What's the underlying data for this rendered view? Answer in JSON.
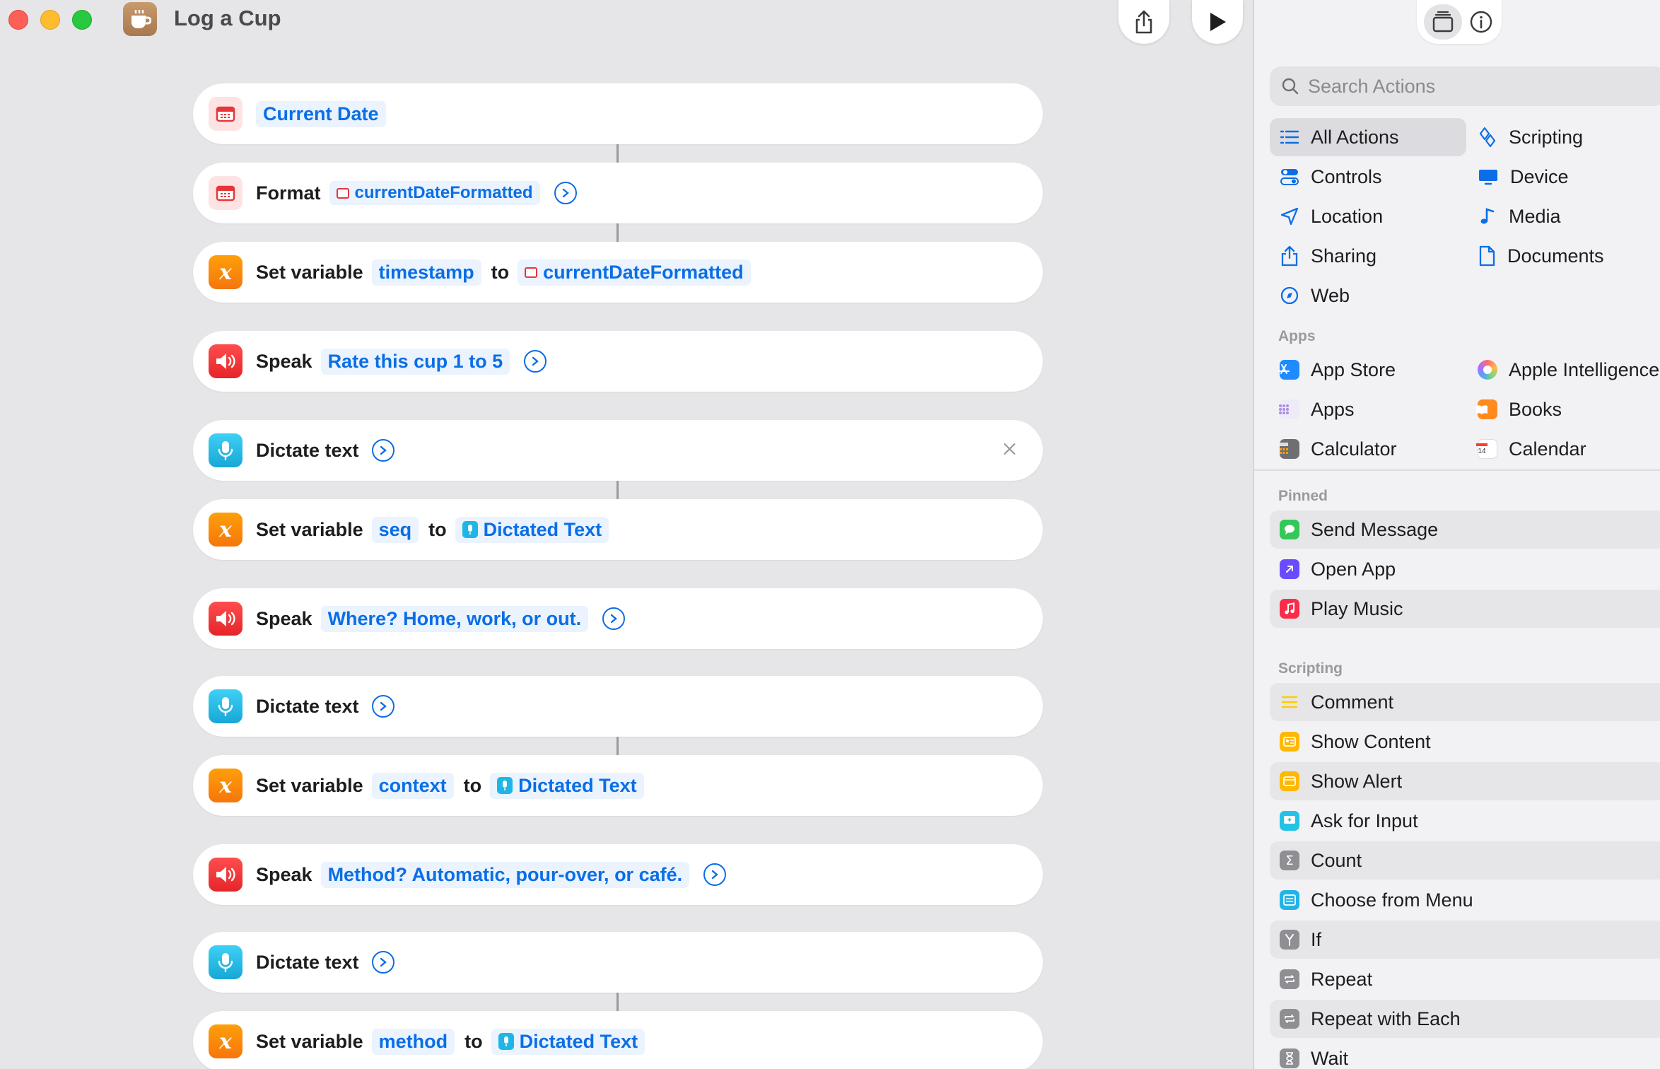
{
  "window": {
    "title": "Log a Cup"
  },
  "actions": [
    {
      "type": "date",
      "tokens": [
        {
          "text": "Current Date",
          "chip": "none"
        }
      ]
    },
    {
      "type": "format",
      "verb": "Format",
      "tokens": [
        {
          "text": "currentDateFormatted",
          "chip": "cal"
        }
      ]
    },
    {
      "type": "setvar",
      "verb": "Set variable",
      "var": "timestamp",
      "to": "to",
      "value": "currentDateFormatted",
      "chip": "cal"
    },
    {
      "type": "speak",
      "verb": "Speak",
      "text": "Rate this cup 1 to 5"
    },
    {
      "type": "dictate",
      "verb": "Dictate text"
    },
    {
      "type": "setvar",
      "verb": "Set variable",
      "var": "seq",
      "to": "to",
      "value": "Dictated Text",
      "chip": "dict"
    },
    {
      "type": "speak",
      "verb": "Speak",
      "text": "Where? Home, work, or out."
    },
    {
      "type": "dictate",
      "verb": "Dictate text"
    },
    {
      "type": "setvar",
      "verb": "Set variable",
      "var": "context",
      "to": "to",
      "value": "Dictated Text",
      "chip": "dict"
    },
    {
      "type": "speak",
      "verb": "Speak",
      "text": "Method? Automatic, pour-over, or café."
    },
    {
      "type": "dictate",
      "verb": "Dictate text"
    },
    {
      "type": "setvar",
      "verb": "Set variable",
      "var": "method",
      "to": "to",
      "value": "Dictated Text",
      "chip": "dict"
    }
  ],
  "sidebar": {
    "search_placeholder": "Search Actions",
    "categories": [
      {
        "label": "All Actions",
        "icon": "list-icon",
        "selected": true
      },
      {
        "label": "Scripting",
        "icon": "scripting-icon"
      },
      {
        "label": "Controls",
        "icon": "controls-icon"
      },
      {
        "label": "Device",
        "icon": "device-icon"
      },
      {
        "label": "Location",
        "icon": "location-icon"
      },
      {
        "label": "Media",
        "icon": "music-note-icon"
      },
      {
        "label": "Sharing",
        "icon": "share-icon"
      },
      {
        "label": "Documents",
        "icon": "document-icon"
      },
      {
        "label": "Web",
        "icon": "compass-icon"
      }
    ],
    "apps_label": "Apps",
    "apps": [
      {
        "label": "App Store",
        "color": "#1f8bff"
      },
      {
        "label": "Apple Intelligence",
        "color": "#e86bd6"
      },
      {
        "label": "Apps",
        "color": "#d9d0f2"
      },
      {
        "label": "Books",
        "color": "#ff8a1f"
      },
      {
        "label": "Calculator",
        "color": "#6e6e73"
      },
      {
        "label": "Calendar",
        "color": "#ffffff"
      }
    ],
    "pinned_label": "Pinned",
    "pinned": [
      {
        "label": "Send Message",
        "color": "#34c759"
      },
      {
        "label": "Open App",
        "color": "#6b4bff"
      },
      {
        "label": "Play Music",
        "color": "#fa2d48"
      }
    ],
    "scripting_label": "Scripting",
    "scripting": [
      {
        "label": "Comment",
        "color": "#ffd60a"
      },
      {
        "label": "Show Content",
        "color": "#ffb800"
      },
      {
        "label": "Show Alert",
        "color": "#ffb800"
      },
      {
        "label": "Ask for Input",
        "color": "#22c3e6"
      },
      {
        "label": "Count",
        "color": "#8e8e93"
      },
      {
        "label": "Choose from Menu",
        "color": "#22b4e6"
      },
      {
        "label": "If",
        "color": "#8e8e93"
      },
      {
        "label": "Repeat",
        "color": "#8e8e93"
      },
      {
        "label": "Repeat with Each",
        "color": "#8e8e93"
      },
      {
        "label": "Wait",
        "color": "#8e8e93"
      }
    ]
  }
}
